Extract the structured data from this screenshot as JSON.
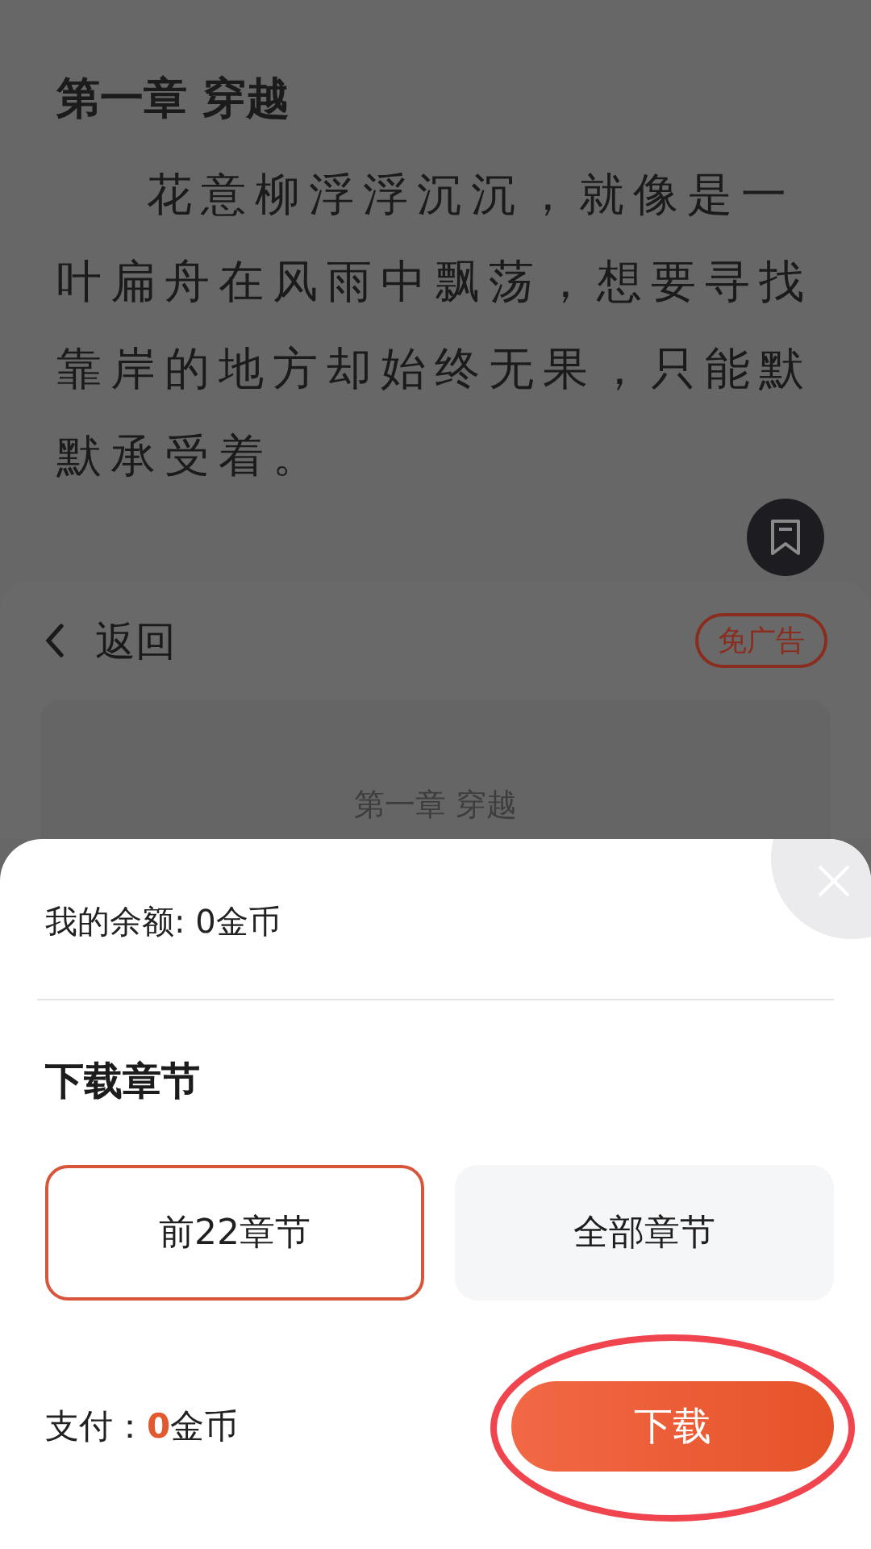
{
  "reader": {
    "chapter_title": "第一章 穿越",
    "paragraph": "花意柳浮浮沉沉，就像是一叶扁舟在风雨中飘荡，想要寻找靠岸的地方却始终无果，只能默默承受着。"
  },
  "toolbar": {
    "back_label": "返回",
    "ad_free_badge": "免广告"
  },
  "chapter_card": "第一章 穿越",
  "sheet": {
    "balance": "我的余额: 0金币",
    "section_title": "下载章节",
    "options": [
      {
        "label": "前22章节",
        "selected": true
      },
      {
        "label": "全部章节",
        "selected": false
      }
    ],
    "pay_label": "支付：",
    "pay_amount": "0",
    "pay_unit": "金币",
    "download_button": "下载"
  }
}
